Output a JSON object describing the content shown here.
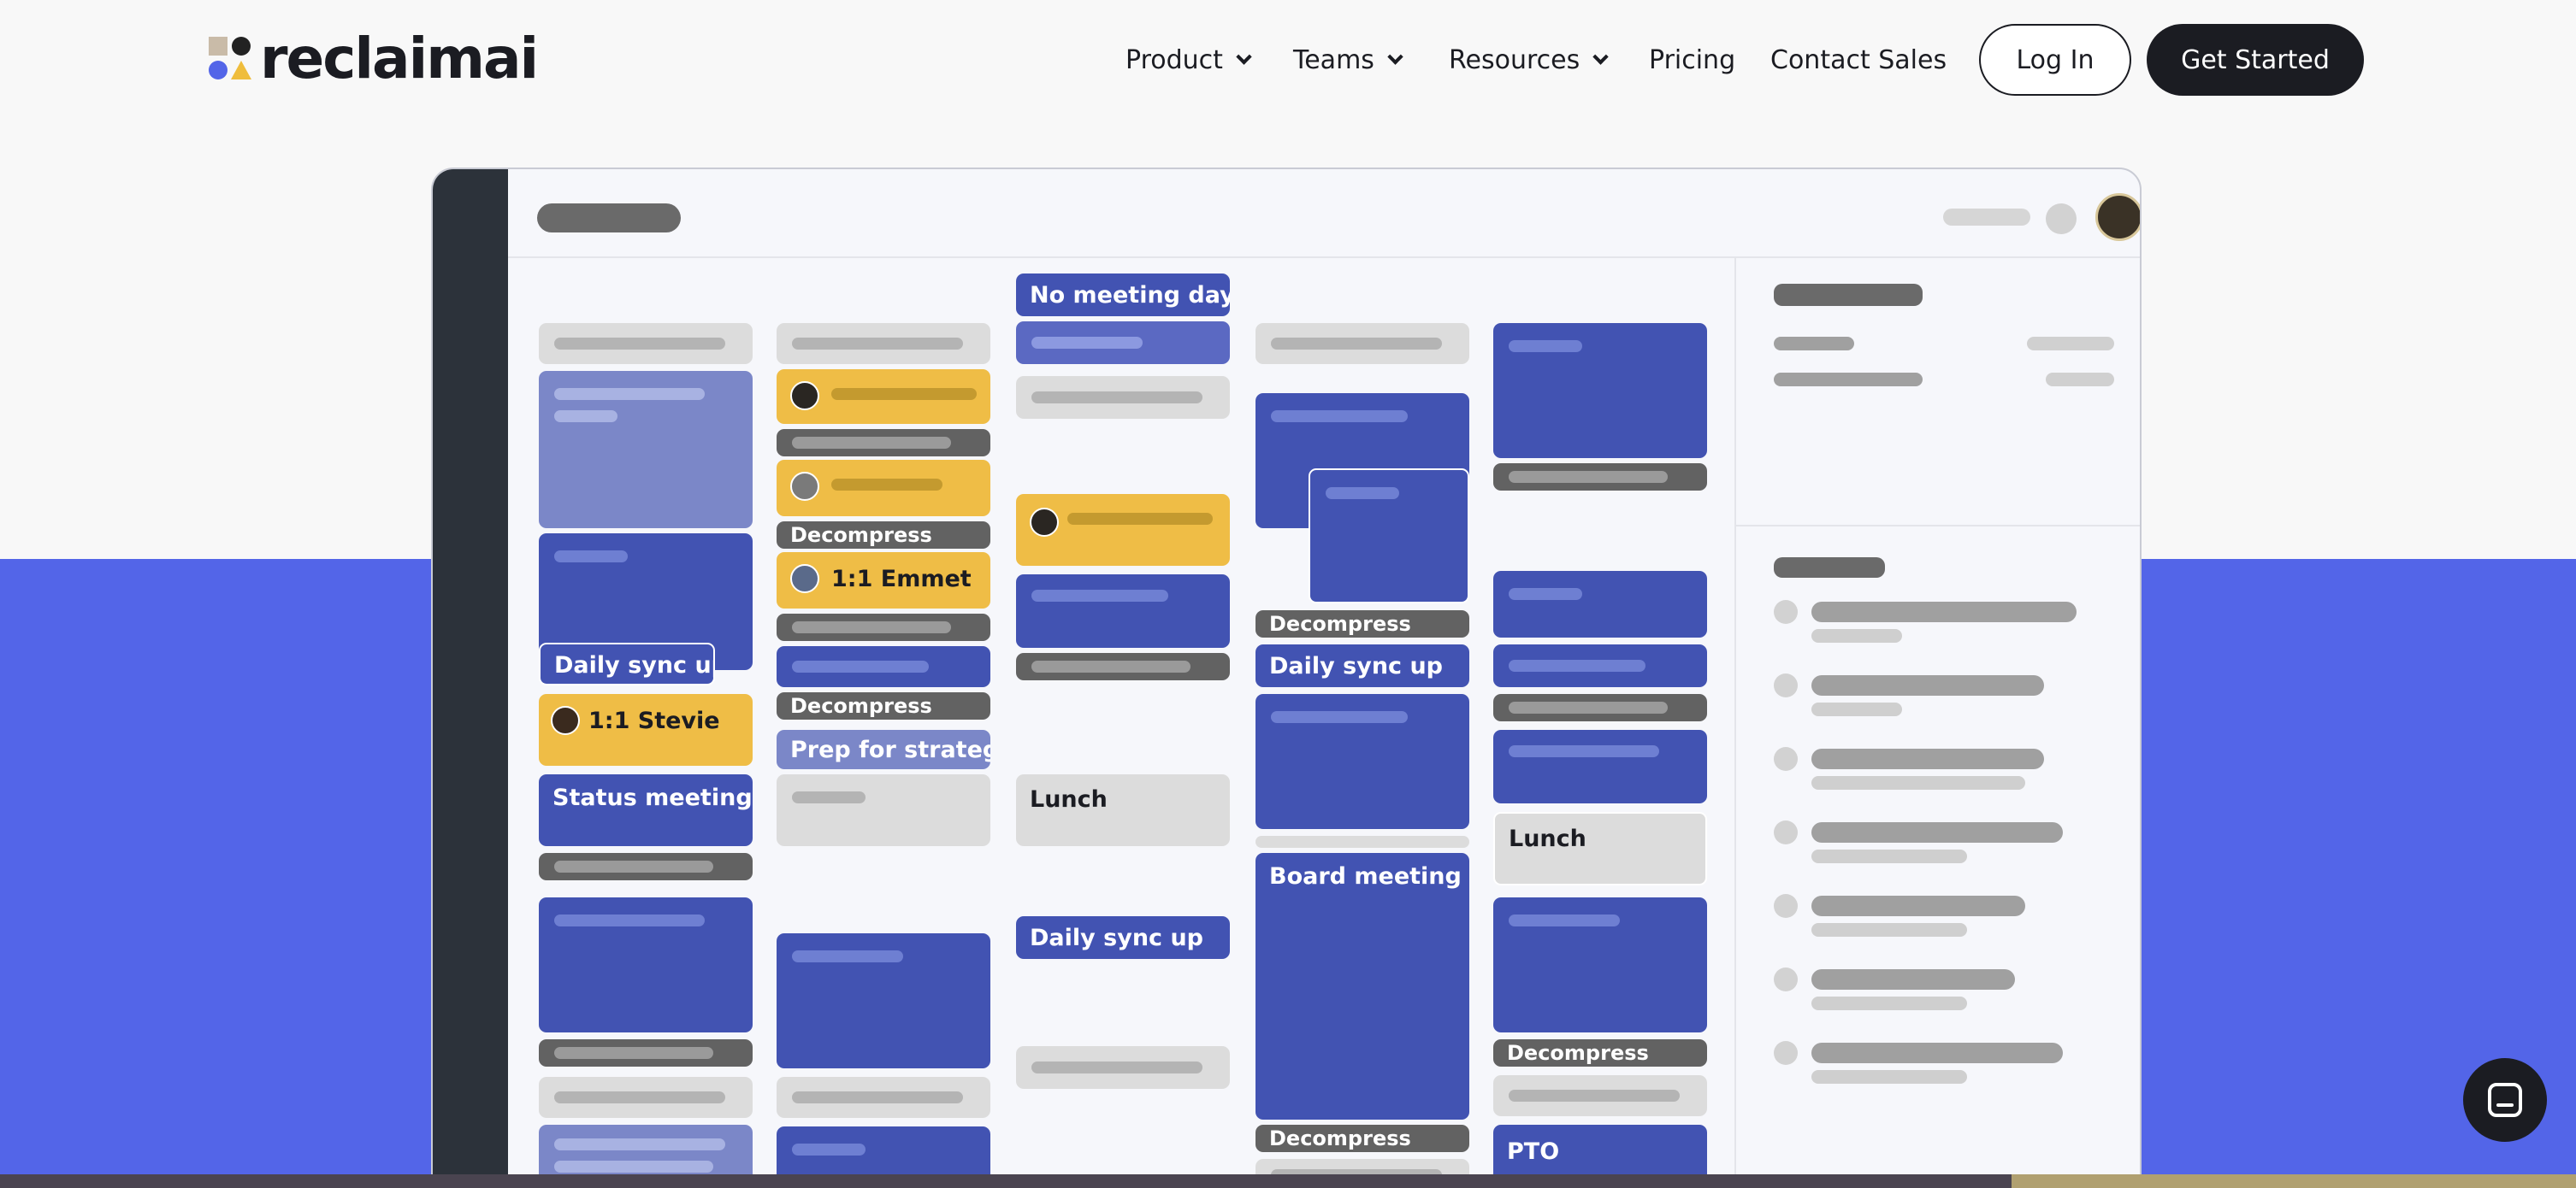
{
  "brand": {
    "name": "reclaimai"
  },
  "nav": {
    "product": "Product",
    "teams": "Teams",
    "resources": "Resources",
    "pricing": "Pricing",
    "contact_sales": "Contact Sales",
    "login": "Log In",
    "get_started": "Get Started"
  },
  "calendar": {
    "events": {
      "no_meeting_day": "No meeting day",
      "daily_sync_up": "Daily sync up",
      "one_on_one_stevie": "1:1 Stevie",
      "one_on_one_emmet": "1:1 Emmet",
      "status_meeting": "Status meeting",
      "decompress": "Decompress",
      "prep_for_strategy": "Prep for strategy",
      "lunch": "Lunch",
      "board_meeting": "Board meeting",
      "pto": "PTO"
    }
  },
  "colors": {
    "brand_blue": "#5365e8",
    "event_blue": "#4253b2",
    "event_yellow": "#efbd46",
    "dark": "#1b1c22"
  }
}
